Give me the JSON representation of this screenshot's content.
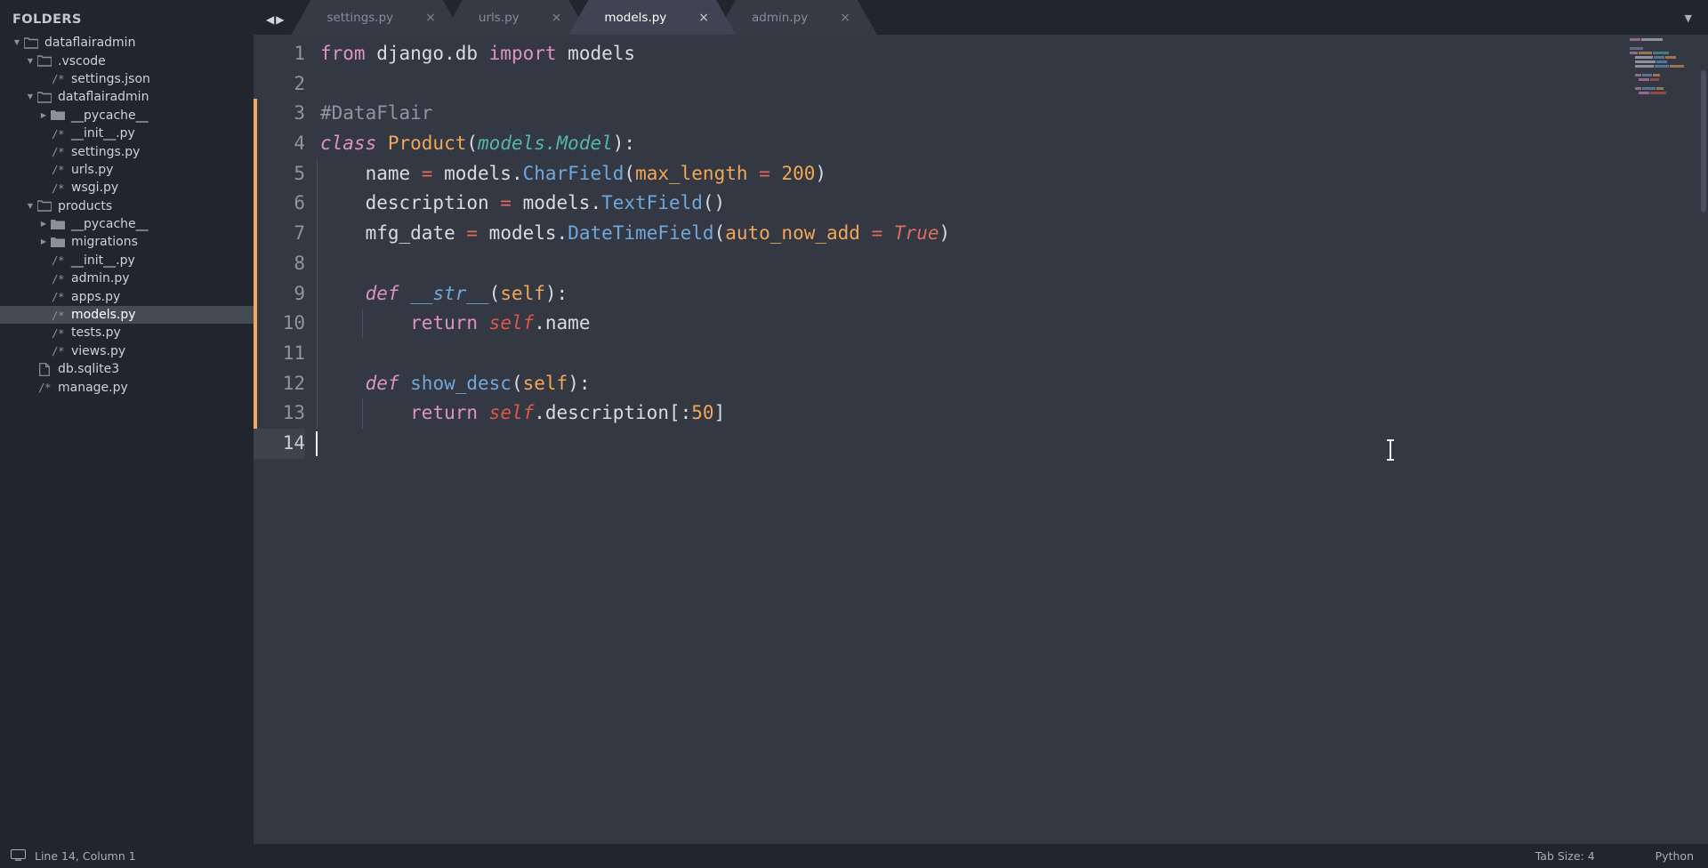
{
  "window": {
    "background": "#2d333d"
  },
  "sidebar": {
    "title": "FOLDERS",
    "items": [
      {
        "label": "dataflairadmin",
        "kind": "folder-open",
        "depth": 0,
        "arrow": "down",
        "selected": false
      },
      {
        "label": ".vscode",
        "kind": "folder-open",
        "depth": 1,
        "arrow": "down",
        "selected": false
      },
      {
        "label": "settings.json",
        "kind": "py-file",
        "depth": 2,
        "arrow": "none",
        "selected": false
      },
      {
        "label": "dataflairadmin",
        "kind": "folder-open",
        "depth": 1,
        "arrow": "down",
        "selected": false
      },
      {
        "label": "__pycache__",
        "kind": "folder",
        "depth": 2,
        "arrow": "right",
        "selected": false
      },
      {
        "label": "__init__.py",
        "kind": "py-file",
        "depth": 2,
        "arrow": "none",
        "selected": false
      },
      {
        "label": "settings.py",
        "kind": "py-file",
        "depth": 2,
        "arrow": "none",
        "selected": false
      },
      {
        "label": "urls.py",
        "kind": "py-file",
        "depth": 2,
        "arrow": "none",
        "selected": false
      },
      {
        "label": "wsgi.py",
        "kind": "py-file",
        "depth": 2,
        "arrow": "none",
        "selected": false
      },
      {
        "label": "products",
        "kind": "folder-open",
        "depth": 1,
        "arrow": "down",
        "selected": false
      },
      {
        "label": "__pycache__",
        "kind": "folder",
        "depth": 2,
        "arrow": "right",
        "selected": false
      },
      {
        "label": "migrations",
        "kind": "folder",
        "depth": 2,
        "arrow": "right",
        "selected": false
      },
      {
        "label": "__init__.py",
        "kind": "py-file",
        "depth": 2,
        "arrow": "none",
        "selected": false
      },
      {
        "label": "admin.py",
        "kind": "py-file",
        "depth": 2,
        "arrow": "none",
        "selected": false
      },
      {
        "label": "apps.py",
        "kind": "py-file",
        "depth": 2,
        "arrow": "none",
        "selected": false
      },
      {
        "label": "models.py",
        "kind": "py-file",
        "depth": 2,
        "arrow": "none",
        "selected": true
      },
      {
        "label": "tests.py",
        "kind": "py-file",
        "depth": 2,
        "arrow": "none",
        "selected": false
      },
      {
        "label": "views.py",
        "kind": "py-file",
        "depth": 2,
        "arrow": "none",
        "selected": false
      },
      {
        "label": "db.sqlite3",
        "kind": "plain-file",
        "depth": 1,
        "arrow": "none",
        "selected": false
      },
      {
        "label": "manage.py",
        "kind": "py-file",
        "depth": 1,
        "arrow": "none",
        "selected": false
      }
    ]
  },
  "tabbar": {
    "nav_prev_icon": "arrow-left-icon",
    "nav_next_icon": "arrow-right-icon",
    "overflow_icon": "chevron-down-icon",
    "close_glyph": "×",
    "tabs": [
      {
        "label": "settings.py",
        "active": false
      },
      {
        "label": "urls.py",
        "active": false
      },
      {
        "label": "models.py",
        "active": true
      },
      {
        "label": "admin.py",
        "active": false
      }
    ]
  },
  "editor": {
    "line_numbers": [
      "1",
      "2",
      "3",
      "4",
      "5",
      "6",
      "7",
      "8",
      "9",
      "10",
      "11",
      "12",
      "13",
      "14"
    ],
    "cursor_line": 14,
    "lines_plain": [
      "from django.db import models",
      "",
      "#DataFlair",
      "class Product(models.Model):",
      "    name = models.CharField(max_length = 200)",
      "    description = models.TextField()",
      "    mfg_date = models.DateTimeField(auto_now_add = True)",
      "",
      "    def __str__(self):",
      "        return self.name",
      "",
      "    def show_desc(self):",
      "        return self.description[:50]",
      ""
    ],
    "tokens": [
      [
        {
          "t": "from ",
          "c": "t-kw2"
        },
        {
          "t": "django.db ",
          "c": "t-plain"
        },
        {
          "t": "import ",
          "c": "t-kw2"
        },
        {
          "t": "models",
          "c": "t-plain"
        }
      ],
      [],
      [
        {
          "t": "#DataFlair",
          "c": "t-comment"
        }
      ],
      [
        {
          "t": "class ",
          "c": "t-kw"
        },
        {
          "t": "Product",
          "c": "t-class"
        },
        {
          "t": "(",
          "c": "t-plain"
        },
        {
          "t": "models.Model",
          "c": "t-type"
        },
        {
          "t": "):",
          "c": "t-plain"
        }
      ],
      [
        {
          "t": "    name ",
          "c": "t-plain"
        },
        {
          "t": "=",
          "c": "t-op"
        },
        {
          "t": " models.",
          "c": "t-plain"
        },
        {
          "t": "CharField",
          "c": "t-fn"
        },
        {
          "t": "(",
          "c": "t-plain"
        },
        {
          "t": "max_length",
          "c": "t-param"
        },
        {
          "t": " ",
          "c": "t-plain"
        },
        {
          "t": "=",
          "c": "t-op"
        },
        {
          "t": " ",
          "c": "t-plain"
        },
        {
          "t": "200",
          "c": "t-num"
        },
        {
          "t": ")",
          "c": "t-plain"
        }
      ],
      [
        {
          "t": "    description ",
          "c": "t-plain"
        },
        {
          "t": "=",
          "c": "t-op"
        },
        {
          "t": " models.",
          "c": "t-plain"
        },
        {
          "t": "TextField",
          "c": "t-fn"
        },
        {
          "t": "()",
          "c": "t-plain"
        }
      ],
      [
        {
          "t": "    mfg_date ",
          "c": "t-plain"
        },
        {
          "t": "=",
          "c": "t-op"
        },
        {
          "t": " models.",
          "c": "t-plain"
        },
        {
          "t": "DateTimeField",
          "c": "t-fn"
        },
        {
          "t": "(",
          "c": "t-plain"
        },
        {
          "t": "auto_now_add",
          "c": "t-param"
        },
        {
          "t": " ",
          "c": "t-plain"
        },
        {
          "t": "=",
          "c": "t-op"
        },
        {
          "t": " ",
          "c": "t-plain"
        },
        {
          "t": "True",
          "c": "t-const"
        },
        {
          "t": ")",
          "c": "t-plain"
        }
      ],
      [],
      [
        {
          "t": "    ",
          "c": "t-plain"
        },
        {
          "t": "def ",
          "c": "t-kw"
        },
        {
          "t": "__str__",
          "c": "t-fn-it"
        },
        {
          "t": "(",
          "c": "t-plain"
        },
        {
          "t": "self",
          "c": "t-param"
        },
        {
          "t": "):",
          "c": "t-plain"
        }
      ],
      [
        {
          "t": "        ",
          "c": "t-plain"
        },
        {
          "t": "return ",
          "c": "t-kw2"
        },
        {
          "t": "self",
          "c": "t-self"
        },
        {
          "t": ".name",
          "c": "t-plain"
        }
      ],
      [],
      [
        {
          "t": "    ",
          "c": "t-plain"
        },
        {
          "t": "def ",
          "c": "t-kw"
        },
        {
          "t": "show_desc",
          "c": "t-fn"
        },
        {
          "t": "(",
          "c": "t-plain"
        },
        {
          "t": "self",
          "c": "t-param"
        },
        {
          "t": "):",
          "c": "t-plain"
        }
      ],
      [
        {
          "t": "        ",
          "c": "t-plain"
        },
        {
          "t": "return ",
          "c": "t-kw2"
        },
        {
          "t": "self",
          "c": "t-self"
        },
        {
          "t": ".description[:",
          "c": "t-plain"
        },
        {
          "t": "50",
          "c": "t-num"
        },
        {
          "t": "]",
          "c": "t-plain"
        }
      ],
      []
    ]
  },
  "statusbar": {
    "icon": "monitor-icon",
    "position": "Line 14, Column 1",
    "tab_size": "Tab Size: 4",
    "syntax": "Python"
  },
  "colors": {
    "sidebar_bg": "#21252d",
    "editor_bg": "#333842",
    "tab_active_bg": "#3e4451",
    "tab_inactive_bg": "#353b45",
    "selection_bg": "#444b55",
    "gutter_mark": "#f7a85c",
    "keyword": "#dd94c0",
    "class_name": "#f2a65a",
    "type_name": "#56b6a8",
    "function": "#6fa8dc",
    "operator": "#e06c5c",
    "self_kw": "#e0564b",
    "comment": "#8f96a1",
    "text": "#d7dce3"
  }
}
